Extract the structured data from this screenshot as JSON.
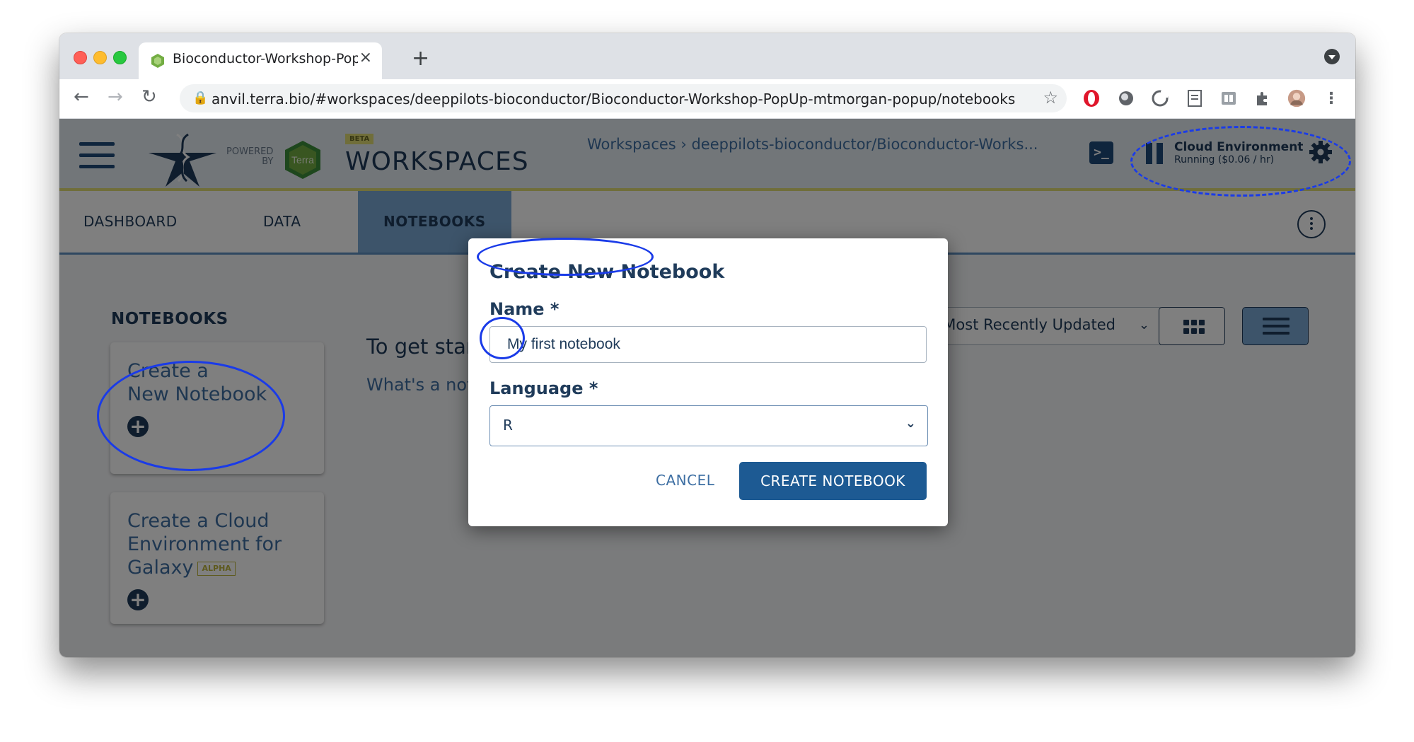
{
  "browser": {
    "tab_title": "Bioconductor-Workshop-PopUp",
    "tab_close": "×",
    "new_tab": "+",
    "url": "anvil.terra.bio/#workspaces/deeppilots-bioconductor/Bioconductor-Workshop-PopUp-mtmorgan-popup/notebooks",
    "back": "←",
    "forward": "→",
    "reload": "↻",
    "star": "☆"
  },
  "header": {
    "powered_by": "POWERED\nBY",
    "terra_logo_text": "Terra",
    "beta_badge": "BETA",
    "title": "WORKSPACES",
    "breadcrumb": "Workspaces › deeppilots-bioconductor/Bioconductor-Works...",
    "cloud_env_title": "Cloud Environment",
    "cloud_env_status": "Running ($0.06 / hr)"
  },
  "tabs": {
    "dashboard": "DASHBOARD",
    "data": "DATA",
    "notebooks": "NOTEBOOKS"
  },
  "notebooks": {
    "section_title": "NOTEBOOKS",
    "create_card_line1": "Create a",
    "create_card_line2": "New Notebook",
    "cloud_card_line1": "Create a Cloud",
    "cloud_card_line2": "Environment for",
    "cloud_card_line3": "Galaxy",
    "alpha_badge": "ALPHA",
    "getting_started": "To get started",
    "whats_a": "What's a notebook?",
    "sort_value": "Most Recently Updated"
  },
  "modal": {
    "title": "Create New Notebook",
    "name_label": "Name *",
    "name_value": "My first notebook",
    "language_label": "Language *",
    "language_value": "R",
    "cancel_label": "CANCEL",
    "create_label": "CREATE NOTEBOOK"
  },
  "colors": {
    "brand_blue": "#1d5a93",
    "annotation": "#1a3be8",
    "beta": "#e0dc74"
  }
}
